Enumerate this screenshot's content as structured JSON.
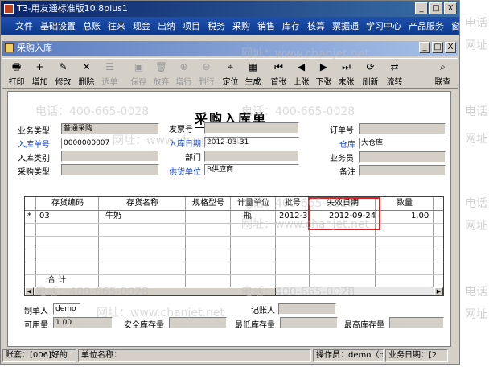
{
  "window": {
    "title": "T3-用友通标准版10.8plus1",
    "min": "_",
    "max": "□",
    "close": "X"
  },
  "menu": [
    "文件",
    "基础设置",
    "总账",
    "往来",
    "现金",
    "出纳",
    "项目",
    "税务",
    "采购",
    "销售",
    "库存",
    "核算",
    "票据通",
    "学习中心",
    "产品服务",
    "窗"
  ],
  "subwindow": {
    "title": "采购入库",
    "min": "_",
    "max": "□",
    "close": "X"
  },
  "toolbar": [
    {
      "label": "打印",
      "icon": "printer-icon",
      "glyph": "🖶",
      "enabled": true
    },
    {
      "label": "增加",
      "icon": "add-icon",
      "glyph": "+",
      "enabled": true
    },
    {
      "label": "修改",
      "icon": "edit-icon",
      "glyph": "✎",
      "enabled": true
    },
    {
      "label": "删除",
      "icon": "delete-icon",
      "glyph": "✕",
      "enabled": true
    },
    {
      "label": "选单",
      "icon": "select-icon",
      "glyph": "☰",
      "enabled": false
    },
    {
      "label": "保存",
      "icon": "save-icon",
      "glyph": "▣",
      "enabled": false
    },
    {
      "label": "放弃",
      "icon": "discard-icon",
      "glyph": "🗑",
      "enabled": false
    },
    {
      "label": "增行",
      "icon": "add-row-icon",
      "glyph": "⊕",
      "enabled": false
    },
    {
      "label": "删行",
      "icon": "delete-row-icon",
      "glyph": "⊖",
      "enabled": false
    },
    {
      "label": "定位",
      "icon": "locate-icon",
      "glyph": "⌖",
      "enabled": true
    },
    {
      "label": "生成",
      "icon": "generate-icon",
      "glyph": "▦",
      "enabled": true
    },
    {
      "label": "首张",
      "icon": "first-icon",
      "glyph": "⏮",
      "enabled": true
    },
    {
      "label": "上张",
      "icon": "prev-icon",
      "glyph": "◀",
      "enabled": true
    },
    {
      "label": "下张",
      "icon": "next-icon",
      "glyph": "▶",
      "enabled": true
    },
    {
      "label": "末张",
      "icon": "last-icon",
      "glyph": "⏭",
      "enabled": true
    },
    {
      "label": "刷新",
      "icon": "refresh-icon",
      "glyph": "⟳",
      "enabled": true
    },
    {
      "label": "流转",
      "icon": "flow-icon",
      "glyph": "⇄",
      "enabled": true
    },
    {
      "label": "联查",
      "icon": "query-icon",
      "glyph": "⌕",
      "enabled": true
    }
  ],
  "form": {
    "title": "采购入库单",
    "labels": {
      "business_type": "业务类型",
      "invoice_no": "发票号",
      "order_no": "订单号",
      "receipt_no": "入库单号",
      "receipt_date": "入库日期",
      "warehouse": "仓库",
      "receipt_category": "入库类别",
      "department": "部门",
      "salesperson": "业务员",
      "purchase_type": "采购类型",
      "supplier": "供货单位",
      "remark": "备注"
    },
    "values": {
      "business_type": "普通采购",
      "invoice_no": "",
      "order_no": "",
      "receipt_no": "0000000007",
      "receipt_date": "2012-03-31",
      "warehouse": "大仓库",
      "receipt_category": "",
      "department": "",
      "salesperson": "",
      "purchase_type": "",
      "supplier": "B供应商",
      "remark": ""
    }
  },
  "grid": {
    "headers": [
      "存货编码",
      "存货名称",
      "规格型号",
      "计量单位",
      "批号",
      "失效日期",
      "数量"
    ],
    "rows": [
      {
        "marker": "*",
        "code": "03",
        "name": "牛奶",
        "spec": "",
        "unit": "瓶",
        "batch": "2012-3-",
        "expiry": "2012-09-24",
        "qty": "1.00"
      }
    ],
    "total_label": "合  计"
  },
  "footer": {
    "maker_label": "制单人",
    "maker_value": "demo",
    "bookkeeper_label": "记账人",
    "available_label": "可用量",
    "available_value": "1.00",
    "safety_label": "安全库存量",
    "min_label": "最低库存量",
    "max_label": "最高库存量"
  },
  "status": {
    "account": "账套：[006]好的",
    "unit": "单位名称：",
    "operator": "操作员：demo（d",
    "date": "业务日期：[2"
  },
  "watermark": {
    "phone": "电话：400-665-0028",
    "site": "网址：www.chanjet.net",
    "side_phone": "电话",
    "side_site": "网址"
  }
}
